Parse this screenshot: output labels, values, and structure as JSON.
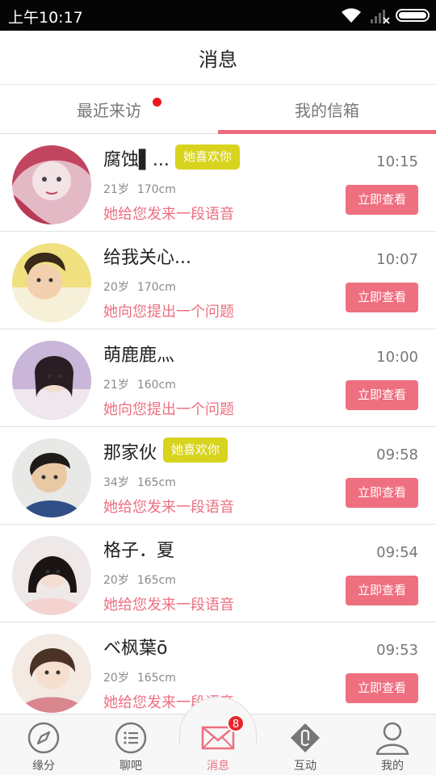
{
  "status_bar": {
    "time": "上午10:17"
  },
  "header": {
    "title": "消息"
  },
  "tabs": [
    {
      "label": "最近来访",
      "has_dot": true
    },
    {
      "label": "我的信箱",
      "active": true
    }
  ],
  "messages": [
    {
      "name": "腐蚀▌...",
      "badge": "她喜欢你",
      "age": "21岁",
      "height": "170cm",
      "text": "她给您发来一段语音",
      "time": "10:15",
      "button": "立即查看"
    },
    {
      "name": "给我关心...",
      "badge": "",
      "age": "20岁",
      "height": "170cm",
      "text": "她向您提出一个问题",
      "time": "10:07",
      "button": "立即查看"
    },
    {
      "name": "萌鹿鹿灬",
      "badge": "",
      "age": "21岁",
      "height": "160cm",
      "text": "她向您提出一个问题",
      "time": "10:00",
      "button": "立即查看"
    },
    {
      "name": "那家伙",
      "badge": "她喜欢你",
      "age": "34岁",
      "height": "165cm",
      "text": "她给您发来一段语音",
      "time": "09:58",
      "button": "立即查看"
    },
    {
      "name": "格子．夏",
      "badge": "",
      "age": "20岁",
      "height": "165cm",
      "text": "她给您发来一段语音",
      "time": "09:54",
      "button": "立即查看"
    },
    {
      "name": "ベ枫葉ō",
      "badge": "",
      "age": "20岁",
      "height": "165cm",
      "text": "她给您发来一段语音",
      "time": "09:53",
      "button": "立即查看"
    }
  ],
  "bottom_nav": [
    {
      "label": "缘分",
      "icon": "compass-icon"
    },
    {
      "label": "聊吧",
      "icon": "list-icon"
    },
    {
      "label": "消息",
      "icon": "envelope-icon",
      "badge": "8",
      "active": true
    },
    {
      "label": "互动",
      "icon": "interact-icon"
    },
    {
      "label": "我的",
      "icon": "person-icon"
    }
  ],
  "colors": {
    "accent": "#ee6f80",
    "badge_yellow": "#d8d31d",
    "dot_red": "#ea1a1f"
  }
}
